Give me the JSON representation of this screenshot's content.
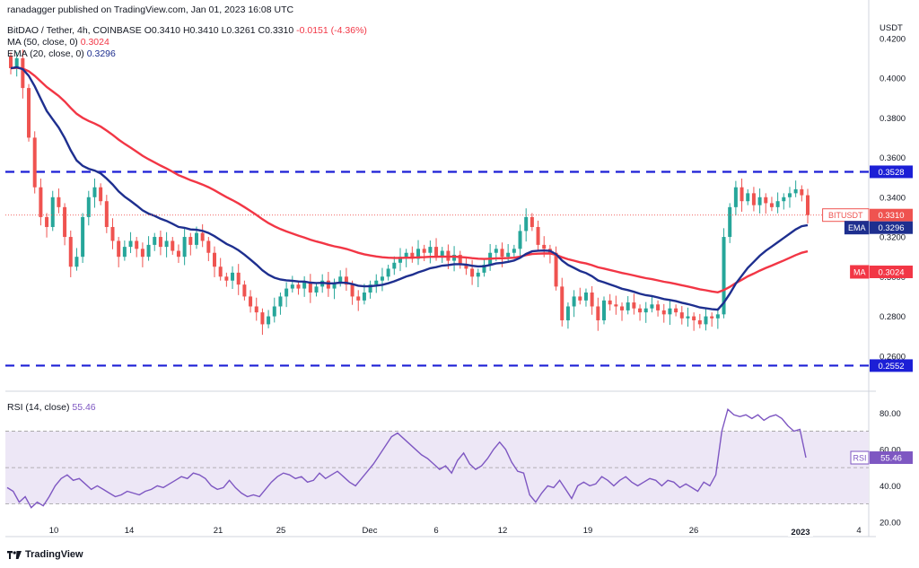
{
  "header": {
    "publisher": "ranadagger published on TradingView.com, Jan 01, 2023 16:08 UTC",
    "symbol_line": "BitDAO / Tether, 4h, COINBASE",
    "ohlc": {
      "o_label": "O",
      "o": "0.3410",
      "h_label": "H",
      "h": "0.3410",
      "l_label": "L",
      "l": "0.3261",
      "c_label": "C",
      "c": "0.3310",
      "change": "-0.0151 (-4.36%)"
    },
    "ma_line": {
      "label": "MA (50, close, 0)",
      "value": "0.3024"
    },
    "ema_line": {
      "label": "EMA (20, close, 0)",
      "value": "0.3296"
    },
    "rsi_line": {
      "label": "RSI (14, close)",
      "value": "55.46"
    }
  },
  "watermark": "TradingView",
  "colors": {
    "up": "#26a69a",
    "down": "#ef5350",
    "ema": "#1e2f8f",
    "ma": "#f23645",
    "rsi": "#7e57c2",
    "level": "#1c1fd6",
    "rsi_band": "#ede7f6"
  },
  "chart_data": [
    {
      "type": "candlestick",
      "title": "BitDAO / Tether, 4h, COINBASE",
      "ylabel": "USDT",
      "ylim": [
        0.245,
        0.433
      ],
      "yticks": [
        "0.4200",
        "0.4000",
        "0.3800",
        "0.3600",
        "0.3400",
        "0.3200",
        "0.3000",
        "0.2800",
        "0.2600"
      ],
      "x_tick_labels": [
        "10",
        "14",
        "21",
        "25",
        "Dec",
        "6",
        "12",
        "19",
        "26",
        "2023",
        "4"
      ],
      "levels": [
        {
          "label": "0.3528",
          "value": 0.3528
        },
        {
          "label": "0.2552",
          "value": 0.2552
        }
      ],
      "price_labels": [
        {
          "name": "BITUSDT",
          "value": "0.3310"
        },
        {
          "name": "EMA",
          "value": "0.3296"
        },
        {
          "name": "MA",
          "value": "0.3024"
        }
      ],
      "closes": [
        0.405,
        0.41,
        0.395,
        0.37,
        0.345,
        0.33,
        0.325,
        0.34,
        0.335,
        0.32,
        0.305,
        0.31,
        0.33,
        0.34,
        0.345,
        0.338,
        0.325,
        0.318,
        0.31,
        0.315,
        0.318,
        0.314,
        0.31,
        0.316,
        0.32,
        0.315,
        0.318,
        0.313,
        0.31,
        0.32,
        0.316,
        0.322,
        0.318,
        0.312,
        0.305,
        0.3,
        0.298,
        0.302,
        0.296,
        0.29,
        0.285,
        0.282,
        0.276,
        0.28,
        0.285,
        0.29,
        0.294,
        0.296,
        0.294,
        0.297,
        0.292,
        0.295,
        0.298,
        0.294,
        0.297,
        0.3,
        0.296,
        0.29,
        0.288,
        0.292,
        0.296,
        0.298,
        0.3,
        0.304,
        0.307,
        0.31,
        0.312,
        0.309,
        0.314,
        0.312,
        0.315,
        0.31,
        0.313,
        0.308,
        0.311,
        0.306,
        0.304,
        0.3,
        0.302,
        0.306,
        0.312,
        0.314,
        0.31,
        0.312,
        0.314,
        0.323,
        0.33,
        0.325,
        0.316,
        0.314,
        0.312,
        0.295,
        0.278,
        0.285,
        0.29,
        0.288,
        0.292,
        0.285,
        0.278,
        0.288,
        0.286,
        0.285,
        0.283,
        0.287,
        0.284,
        0.282,
        0.284,
        0.286,
        0.283,
        0.281,
        0.284,
        0.282,
        0.279,
        0.28,
        0.278,
        0.276,
        0.28,
        0.279,
        0.281,
        0.32,
        0.335,
        0.345,
        0.338,
        0.342,
        0.336,
        0.34,
        0.337,
        0.335,
        0.338,
        0.34,
        0.342,
        0.344,
        0.341,
        0.331
      ],
      "series": [
        {
          "name": "MA (50, close, 0)",
          "last": 0.3024
        },
        {
          "name": "EMA (20, close, 0)",
          "last": 0.3296
        }
      ]
    },
    {
      "type": "line",
      "title": "RSI (14, close)",
      "ylim": [
        17,
        90
      ],
      "yticks": [
        "80.00",
        "60.00",
        "40.00",
        "20.00"
      ],
      "bands": [
        70,
        50,
        30
      ],
      "last_label": "55.46",
      "values": [
        39,
        37,
        31,
        34,
        28,
        31,
        29,
        34,
        40,
        44,
        46,
        43,
        44,
        41,
        38,
        40,
        38,
        36,
        34,
        35,
        37,
        36,
        35,
        37,
        38,
        40,
        39,
        41,
        43,
        45,
        44,
        47,
        46,
        44,
        40,
        38,
        39,
        43,
        39,
        36,
        34,
        35,
        34,
        38,
        42,
        45,
        47,
        46,
        44,
        45,
        42,
        43,
        47,
        44,
        46,
        48,
        45,
        42,
        40,
        44,
        48,
        52,
        57,
        62,
        67,
        69,
        66,
        63,
        60,
        57,
        55,
        52,
        49,
        51,
        47,
        54,
        58,
        52,
        49,
        51,
        55,
        60,
        64,
        60,
        53,
        48,
        47,
        35,
        31,
        36,
        40,
        39,
        43,
        38,
        33,
        40,
        42,
        40,
        41,
        45,
        43,
        40,
        43,
        45,
        42,
        40,
        42,
        44,
        43,
        40,
        43,
        42,
        39,
        41,
        39,
        37,
        42,
        40,
        46,
        70,
        82,
        79,
        78,
        79,
        77,
        79,
        76,
        78,
        79,
        77,
        73,
        70,
        71,
        55.46
      ]
    }
  ]
}
